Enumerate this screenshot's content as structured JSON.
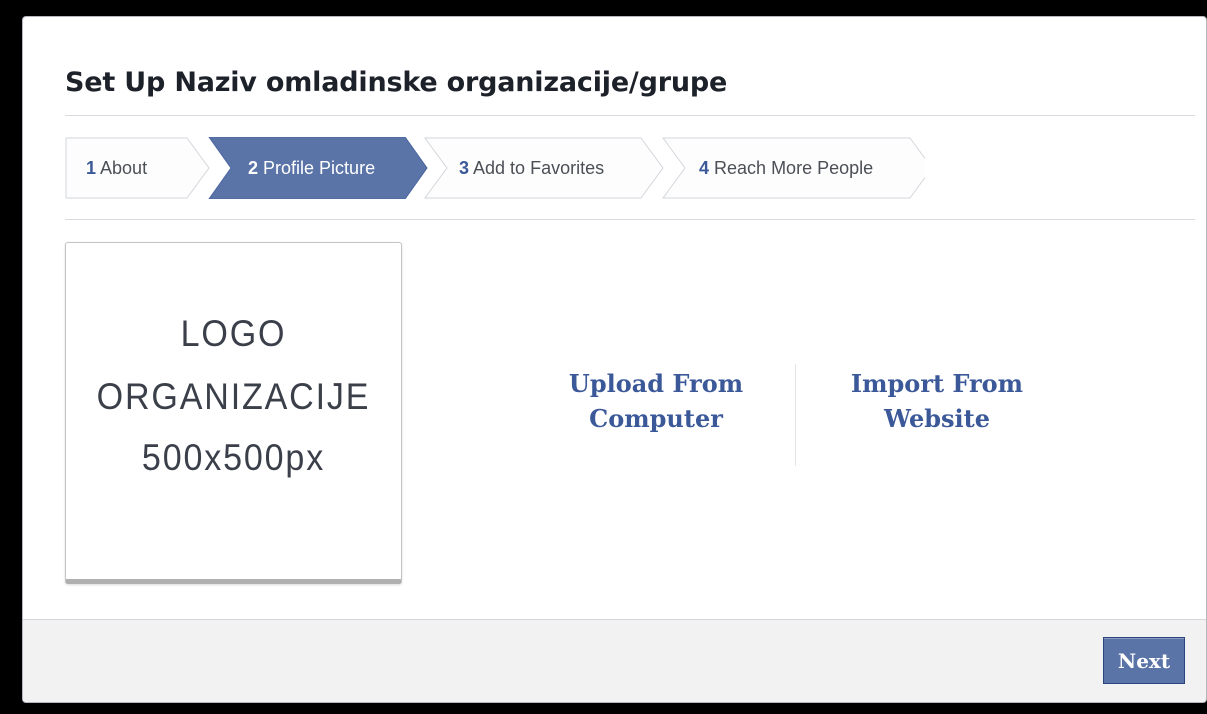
{
  "dialog": {
    "title": "Set Up Naziv omladinske organizacije/grupe"
  },
  "steps": {
    "active_index": 2,
    "items": [
      {
        "number": "1",
        "label": "About"
      },
      {
        "number": "2",
        "label": "Profile Picture"
      },
      {
        "number": "3",
        "label": "Add to Favorites"
      },
      {
        "number": "4",
        "label": "Reach More People"
      }
    ]
  },
  "logo_placeholder": {
    "line1": "LOGO",
    "line2": "ORGANIZACIJE",
    "line3": "500x500px"
  },
  "actions": {
    "upload_line1": "Upload From",
    "upload_line2": "Computer",
    "import_line1": "Import From",
    "import_line2": "Website"
  },
  "footer": {
    "next_label": "Next"
  },
  "colors": {
    "accent": "#3b5998",
    "active_step": "#5b74a8",
    "footer_bg": "#f2f2f2",
    "page_bg": "#000000"
  }
}
